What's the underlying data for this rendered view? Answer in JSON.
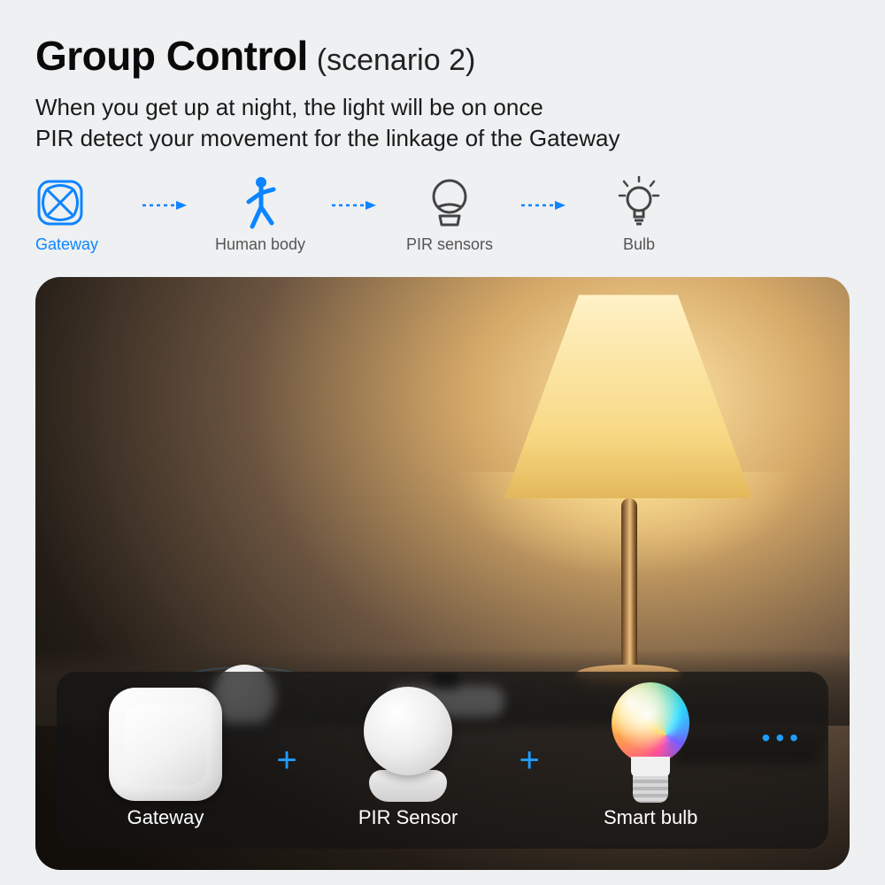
{
  "title_bold": "Group Control",
  "title_sub": "(scenario 2)",
  "description": "When you get up at night, the light will be on once\nPIR detect your movement for the linkage of the Gateway",
  "flow": {
    "gateway": "Gateway",
    "human": "Human body",
    "pir": "PIR sensors",
    "bulb": "Bulb"
  },
  "products": {
    "gateway": "Gateway",
    "sensor": "PIR Sensor",
    "bulb": "Smart bulb",
    "plus": "+",
    "more": "•••"
  },
  "colors": {
    "accent": "#0d84ff"
  }
}
